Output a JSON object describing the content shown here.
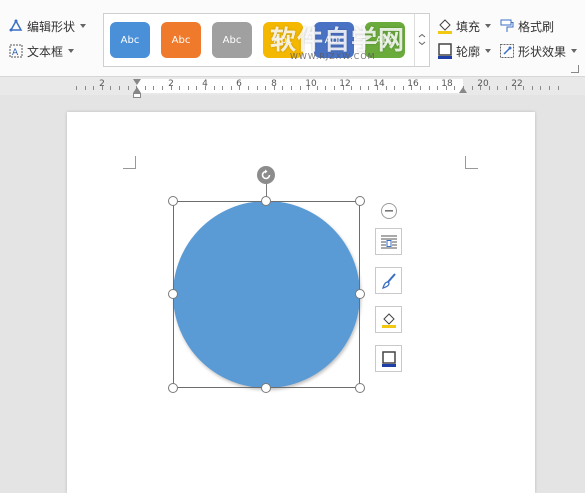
{
  "ribbon": {
    "edit_shape": "编辑形状",
    "text_box": "文本框",
    "fill": "填充",
    "outline": "轮廓",
    "format_painter": "格式刷",
    "shape_effects": "形状效果"
  },
  "gallery": {
    "styles": [
      {
        "label": "Abc",
        "color": "#4a90d9"
      },
      {
        "label": "Abc",
        "color": "#ef7a2c"
      },
      {
        "label": "Abc",
        "color": "#a0a0a0"
      },
      {
        "label": "Abc",
        "color": "#f5b800"
      },
      {
        "label": "Abc",
        "color": "#4a72c4"
      },
      {
        "label": "Abc",
        "color": "#6aab3c"
      }
    ],
    "watermark": "软件自学网",
    "watermark_url": "WWW.RJZXW.COM"
  },
  "ruler": {
    "labels": [
      "2",
      "2",
      "4",
      "6",
      "8",
      "10",
      "12",
      "14",
      "16",
      "18",
      "20",
      "22"
    ]
  },
  "colors": {
    "shape_fill": "#5b9bd5",
    "selection_border": "#6d6d6d"
  },
  "icons": {
    "rotate": "rotate-icon",
    "collapse": "minus-circle-icon",
    "layout_options": "text-wrap-icon",
    "shape_style": "paint-brush-icon",
    "shape_fill": "fill-bucket-icon",
    "shape_outline": "outline-square-icon"
  }
}
